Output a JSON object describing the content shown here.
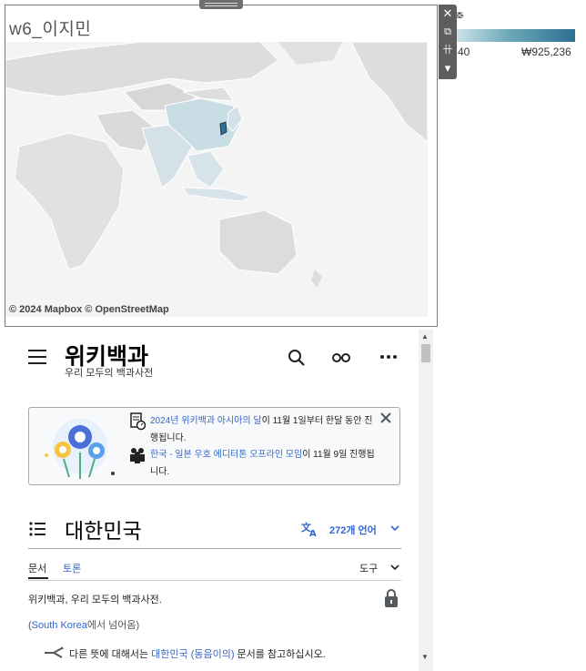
{
  "legend": {
    "min": "40",
    "max": "₩925,236",
    "top_glyph": "출"
  },
  "viz": {
    "title": "w6_이지민",
    "credit": "© 2024 Mapbox © OpenStreetMap"
  },
  "toolbar": {
    "close": "✕",
    "popout": "⧉",
    "pin": "卄",
    "menu": "▾"
  },
  "wiki": {
    "logo": "위키백과",
    "tagline": "우리 모두의 백과사전",
    "banner": {
      "line1_link": "2024년 위키백과 아시아의 달",
      "line1_rest": "이 11월 1일부터 한달 동안 진행됩니다.",
      "line2_link": "한국 - 일본 우호 에디터톤 오프라인 모임",
      "line2_rest": "이 11월 9일 진행됩니다."
    },
    "page_title": "대한민국",
    "languages": "272개 언어",
    "tabs": {
      "article": "문서",
      "talk": "토론",
      "tools": "도구"
    },
    "from": "위키백과, 우리 모두의 백과사전.",
    "redirect": {
      "open": "(",
      "link": "South Korea",
      "rest": "에서 넘어옴)"
    },
    "hatnote": {
      "pre": "다른 뜻에 대해서는 ",
      "link1": "대한민국",
      "mid": " ",
      "link2": "(동음이의)",
      "post": " 문서를 참고하십시오."
    }
  },
  "scroll": {
    "up": "▲",
    "down": "▼"
  },
  "colors": {
    "accent": "#3366cc",
    "map_land": "#dcdcdc",
    "map_korea": "#2f6f93"
  }
}
